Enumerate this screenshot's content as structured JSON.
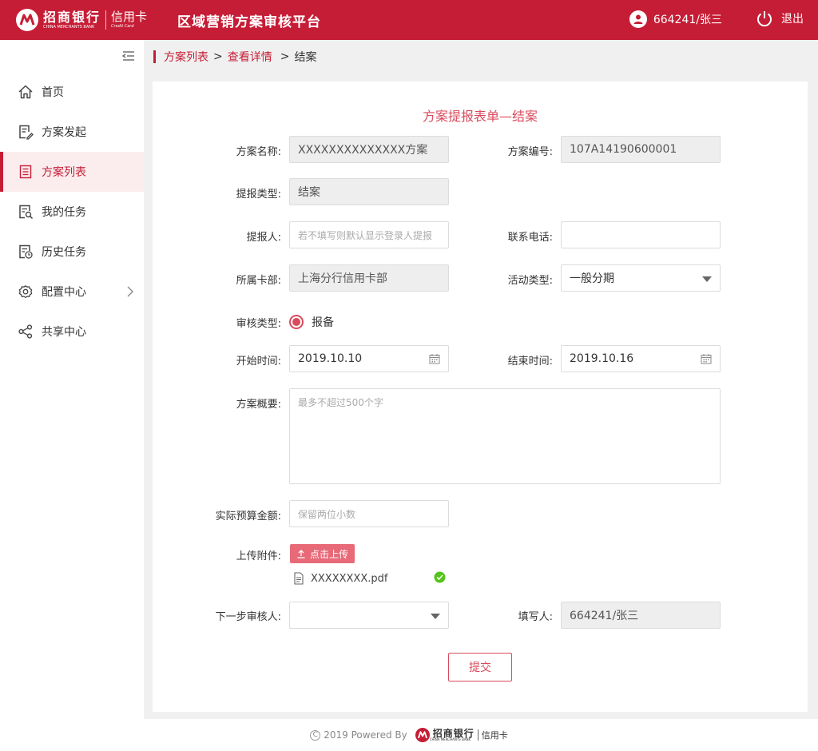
{
  "header": {
    "logo_cn": "招商银行",
    "logo_en": "CHINA MERCHANTS BANK",
    "logo_card_cn": "信用卡",
    "logo_card_en": "Credit Card",
    "app_title": "区域营销方案审核平台",
    "user": "664241/张三",
    "logout": "退出"
  },
  "sidebar": {
    "items": [
      {
        "label": "首页",
        "icon": "home-icon"
      },
      {
        "label": "方案发起",
        "icon": "edit-doc-icon"
      },
      {
        "label": "方案列表",
        "icon": "list-doc-icon",
        "active": true
      },
      {
        "label": "我的任务",
        "icon": "task-search-icon"
      },
      {
        "label": "历史任务",
        "icon": "history-doc-icon"
      },
      {
        "label": "配置中心",
        "icon": "gear-icon"
      },
      {
        "label": "共享中心",
        "icon": "share-icon"
      }
    ]
  },
  "breadcrumb": {
    "items": [
      "方案列表",
      "查看详情",
      "结案"
    ],
    "separator": ">"
  },
  "form": {
    "title": "方案提报表单—结案",
    "plan_name_label": "方案名称:",
    "plan_name_value": "XXXXXXXXXXXXXX方案",
    "plan_no_label": "方案编号:",
    "plan_no_value": "107A14190600001",
    "report_type_label": "提报类型:",
    "report_type_value": "结案",
    "reporter_label": "提报人:",
    "reporter_placeholder": "若不填写则默认显示登录人提报",
    "phone_label": "联系电话:",
    "phone_value": "",
    "dept_label": "所属卡部:",
    "dept_value": "上海分行信用卡部",
    "activity_label": "活动类型:",
    "activity_value": "一般分期",
    "review_type_label": "审核类型:",
    "review_type_option": "报备",
    "start_label": "开始时间:",
    "start_value": "2019.10.10",
    "end_label": "结束时间:",
    "end_value": "2019.10.16",
    "summary_label": "方案概要:",
    "summary_placeholder": "最多不超过500个字",
    "budget_label": "实际预算金额:",
    "budget_placeholder": "保留两位小数",
    "upload_label": "上传附件:",
    "upload_button": "点击上传",
    "file_name": "XXXXXXXX.pdf",
    "next_reviewer_label": "下一步审核人:",
    "next_reviewer_value": "",
    "filler_label": "填写人:",
    "filler_value": "664241/张三",
    "submit": "提交"
  },
  "footer": {
    "copyright_symbol": "C",
    "text": "2019 Powered By",
    "logo_cn": "招商银行",
    "logo_en": "CHINA MERCHANTS BANK",
    "logo_card": "信用卡"
  },
  "colors": {
    "brand": "#c61d36",
    "accent": "#d94b5c",
    "success": "#52c41a"
  }
}
